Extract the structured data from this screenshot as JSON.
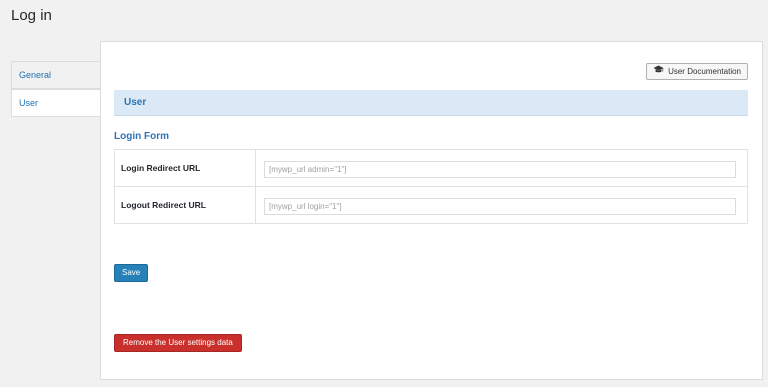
{
  "page": {
    "title": "Log in"
  },
  "tabs": [
    {
      "label": "General"
    },
    {
      "label": "User"
    }
  ],
  "toolbar": {
    "doc_label": "User Documentation"
  },
  "section": {
    "title": "User"
  },
  "form": {
    "heading": "Login Form",
    "rows": [
      {
        "label": "Login Redirect URL",
        "placeholder": "[mywp_url admin=\"1\"]"
      },
      {
        "label": "Logout Redirect URL",
        "placeholder": "[mywp_url login=\"1\"]"
      }
    ]
  },
  "actions": {
    "save_label": "Save",
    "remove_label": "Remove the User settings data"
  },
  "colors": {
    "accent": "#2581b8",
    "danger": "#c9302c",
    "section_bg": "#dbe8f5"
  }
}
